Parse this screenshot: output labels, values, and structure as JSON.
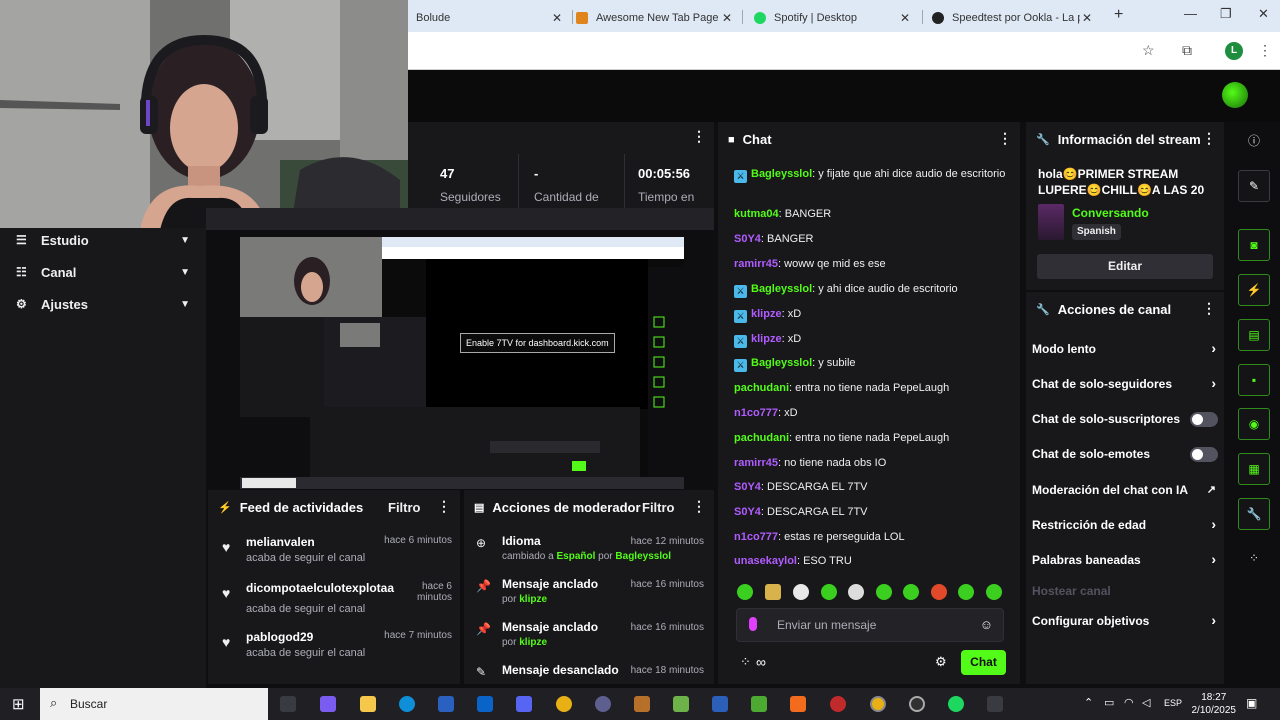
{
  "browser": {
    "tabs": [
      {
        "title": "Bolude",
        "color": "#53fc18"
      },
      {
        "title": "Awesome New Tab Page",
        "color": "#e0851e"
      },
      {
        "title": "Spotify | Desktop",
        "color": "#1ed760"
      },
      {
        "title": "Speedtest por Ookla - La pru",
        "color": "#222222"
      }
    ],
    "profile_initial": "L"
  },
  "nav": [
    {
      "label": "Estudio",
      "icon": "sliders-icon"
    },
    {
      "label": "Canal",
      "icon": "list-icon"
    },
    {
      "label": "Ajustes",
      "icon": "gear-icon"
    }
  ],
  "stats": [
    {
      "value": "47",
      "label": "Seguidores"
    },
    {
      "value": "-",
      "label": "Cantidad de"
    },
    {
      "value": "00:05:56",
      "label": "Tiempo en"
    }
  ],
  "preview": {
    "tooltip": "Enable 7TV for dashboard.kick.com"
  },
  "feed": {
    "title": "Feed de actividades",
    "filter": "Filtro",
    "items": [
      {
        "name": "melianvalen",
        "desc": "acaba de seguir el canal",
        "time": "hace 6 minutos"
      },
      {
        "name": "dicompotaelculotexplotaa",
        "desc": "acaba de seguir el canal",
        "time": "hace 6 minutos"
      },
      {
        "name": "pablogod29",
        "desc": "acaba de seguir el canal",
        "time": "hace 7 minutos"
      }
    ]
  },
  "mod": {
    "title": "Acciones de moderador",
    "filter": "Filtro",
    "items": [
      {
        "title": "Idioma",
        "pre": "cambiado a ",
        "hl1": "Español",
        "mid": " por ",
        "hl2": "Bagleysslol",
        "time": "hace 12 minutos",
        "icon": "globe-icon"
      },
      {
        "title": "Mensaje anclado",
        "pre": "por ",
        "hl1": "klipze",
        "mid": "",
        "hl2": "",
        "time": "hace 16 minutos",
        "icon": "pin-icon"
      },
      {
        "title": "Mensaje anclado",
        "pre": "por ",
        "hl1": "klipze",
        "mid": "",
        "hl2": "",
        "time": "hace 16 minutos",
        "icon": "pin-icon"
      },
      {
        "title": "Mensaje desanclado",
        "pre": "",
        "hl1": "",
        "mid": "",
        "hl2": "",
        "time": "hace 18 minutos",
        "icon": "unpin-icon"
      }
    ]
  },
  "chat": {
    "title": "Chat",
    "messages": [
      {
        "user": "Bagleysslol",
        "color": "#53fc18",
        "badge": true,
        "text": ": y fijate que ahi dice audio de escritorio"
      },
      {
        "user": "kutma04",
        "color": "#53fc18",
        "badge": false,
        "text": ": BANGER"
      },
      {
        "user": "S0Y4",
        "color": "#b15cff",
        "badge": false,
        "text": ": BANGER"
      },
      {
        "user": "ramirr45",
        "color": "#b15cff",
        "badge": false,
        "text": ": woww qe mid es ese"
      },
      {
        "user": "Bagleysslol",
        "color": "#53fc18",
        "badge": true,
        "text": ": y ahi dice audio de escritorio"
      },
      {
        "user": "klipze",
        "color": "#b15cff",
        "badge": true,
        "text": ": xD"
      },
      {
        "user": "klipze",
        "color": "#b15cff",
        "badge": true,
        "text": ": xD"
      },
      {
        "user": "Bagleysslol",
        "color": "#53fc18",
        "badge": true,
        "text": ": y subile"
      },
      {
        "user": "pachudani",
        "color": "#53fc18",
        "badge": false,
        "text": ": entra no tiene nada PepeLaugh"
      },
      {
        "user": "n1co777",
        "color": "#b15cff",
        "badge": false,
        "text": ": xD"
      },
      {
        "user": "pachudani",
        "color": "#53fc18",
        "badge": false,
        "text": ": entra no tiene nada PepeLaugh"
      },
      {
        "user": "ramirr45",
        "color": "#b15cff",
        "badge": false,
        "text": ": no tiene nada obs IO"
      },
      {
        "user": "S0Y4",
        "color": "#b15cff",
        "badge": false,
        "text": ": DESCARGA EL 7TV"
      },
      {
        "user": "S0Y4",
        "color": "#b15cff",
        "badge": false,
        "text": ": DESCARGA EL 7TV"
      },
      {
        "user": "n1co777",
        "color": "#b15cff",
        "badge": false,
        "text": ": estas re perseguida LOL"
      },
      {
        "user": "unasekaylol",
        "color": "#b15cff",
        "badge": false,
        "text": ": ESO TRU"
      }
    ],
    "input_placeholder": "Enviar un mensaje",
    "send_label": "Chat"
  },
  "stream_info": {
    "title": "Información del stream",
    "stream_title": "hola😊PRIMER STREAM LUPERE😊CHILL😊A LAS 20 ...",
    "category": "Conversando",
    "language": "Spanish",
    "edit_label": "Editar"
  },
  "channel_actions": {
    "title": "Acciones de canal",
    "items": [
      {
        "label": "Modo lento",
        "kind": "chevron"
      },
      {
        "label": "Chat de solo-seguidores",
        "kind": "chevron"
      },
      {
        "label": "Chat de solo-suscriptores",
        "kind": "toggle"
      },
      {
        "label": "Chat de solo-emotes",
        "kind": "toggle"
      },
      {
        "label": "Moderación del chat con IA",
        "kind": "external"
      },
      {
        "label": "Restricción de edad",
        "kind": "chevron"
      },
      {
        "label": "Palabras baneadas",
        "kind": "chevron"
      },
      {
        "label": "Hostear canal",
        "kind": "disabled"
      },
      {
        "label": "Configurar objetivos",
        "kind": "chevron"
      }
    ]
  },
  "taskbar": {
    "search_label": "Buscar",
    "language": "ESP",
    "time": "18:27",
    "date": "2/10/2025"
  }
}
